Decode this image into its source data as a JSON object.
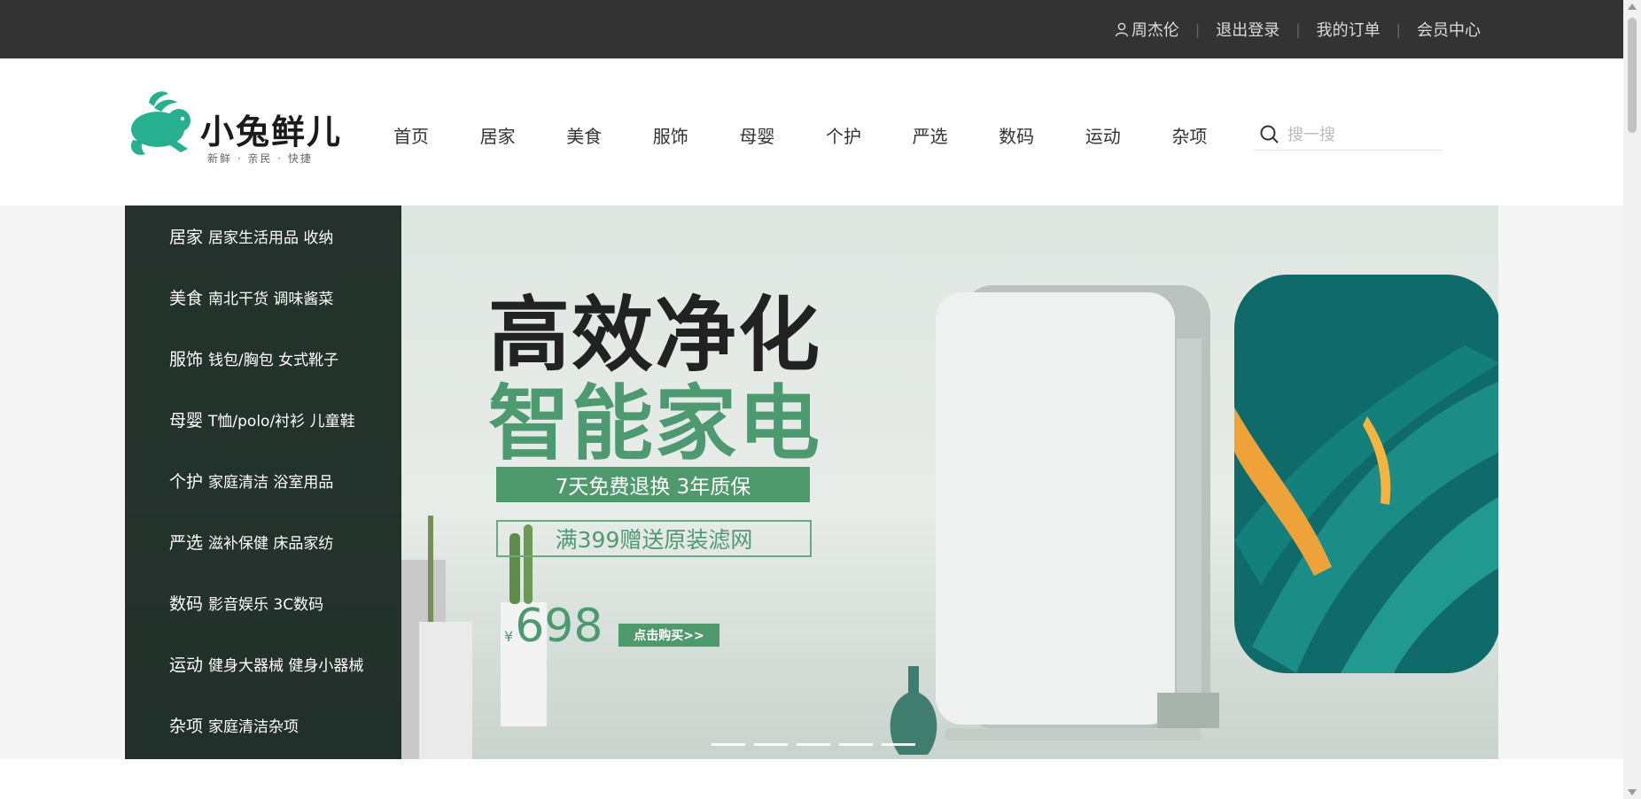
{
  "topbar": {
    "user_name": "周杰伦",
    "logout": "退出登录",
    "orders": "我的订单",
    "member_center": "会员中心",
    "user_icon": "user-icon"
  },
  "logo": {
    "name": "小兔鲜儿",
    "slogan": "新鲜 · 亲民 · 快捷"
  },
  "nav": {
    "items": [
      "首页",
      "居家",
      "美食",
      "服饰",
      "母婴",
      "个护",
      "严选",
      "数码",
      "运动",
      "杂项"
    ]
  },
  "search": {
    "placeholder": "搜一搜",
    "icon": "search-icon"
  },
  "categories": [
    {
      "name": "居家",
      "sub": "居家生活用品 收纳"
    },
    {
      "name": "美食",
      "sub": "南北干货 调味酱菜"
    },
    {
      "name": "服饰",
      "sub": "钱包/胸包 女式靴子"
    },
    {
      "name": "母婴",
      "sub": "T恤/polo/衬衫 儿童鞋"
    },
    {
      "name": "个护",
      "sub": "家庭清洁 浴室用品"
    },
    {
      "name": "严选",
      "sub": "滋补保健 床品家纺"
    },
    {
      "name": "数码",
      "sub": "影音娱乐 3C数码"
    },
    {
      "name": "运动",
      "sub": "健身大器械 健身小器械"
    },
    {
      "name": "杂项",
      "sub": "家庭清洁杂项"
    }
  ],
  "banner": {
    "title_line1": "高效净化",
    "title_line2": "智能家电",
    "badge": "7天免费退换 3年质保",
    "gift": "满399赠送原装滤网",
    "currency": "¥",
    "price": "698",
    "buy_label": "点击购买>>",
    "slide_count": 5,
    "colors": {
      "accent": "#4f9a6c",
      "menu_bg": "#14221c",
      "topbar_bg": "#333333"
    }
  }
}
